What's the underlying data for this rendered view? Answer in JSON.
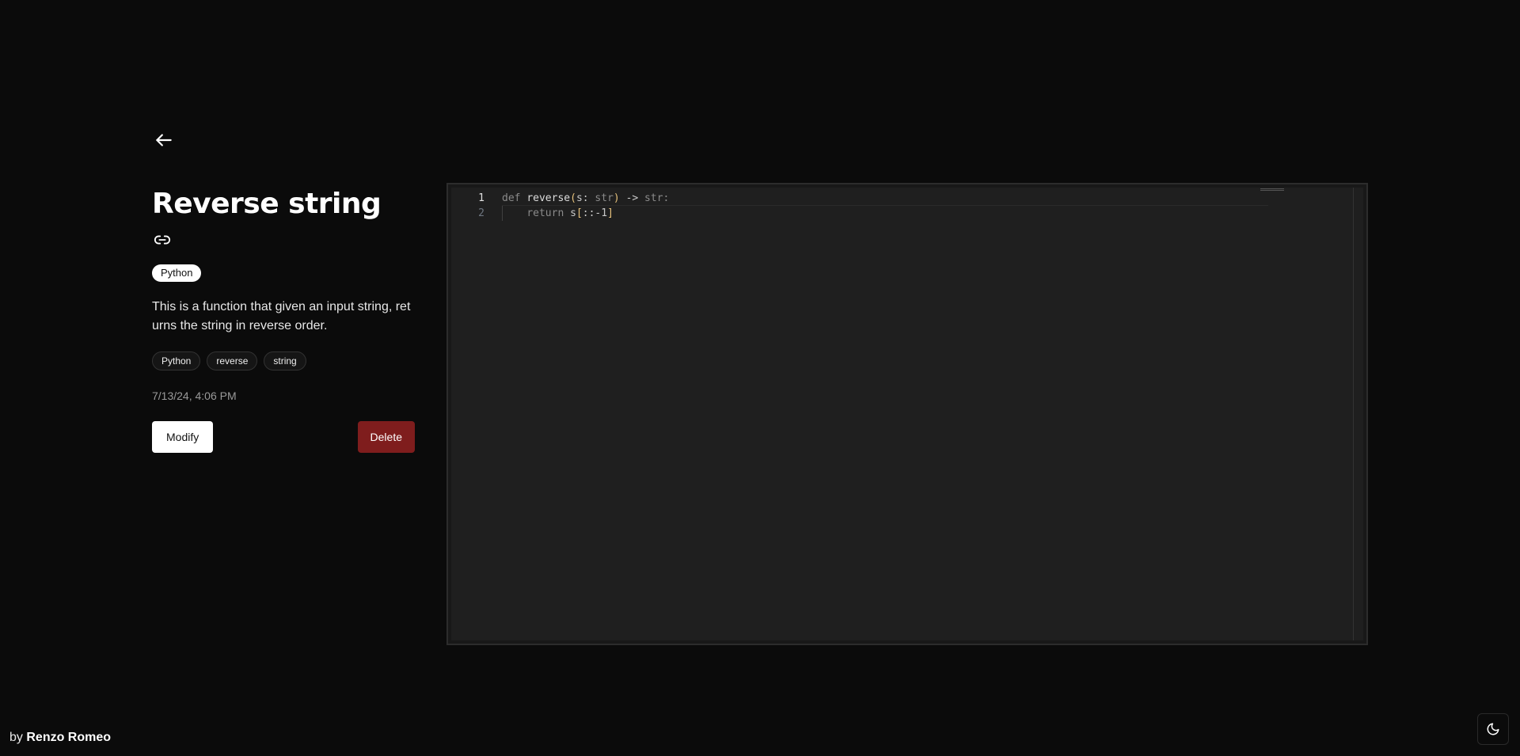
{
  "icons": {
    "back": "arrow-left-icon",
    "link": "link-icon",
    "theme": "moon-icon"
  },
  "snippet": {
    "title": "Reverse string",
    "language": "Python",
    "description": "This is a function that given an input string, returns the string in reverse order.",
    "tags": [
      "Python",
      "reverse",
      "string"
    ],
    "date": "7/13/24, 4:06 PM"
  },
  "actions": {
    "modify_label": "Modify",
    "delete_label": "Delete"
  },
  "editor": {
    "line_numbers": [
      "1",
      "2"
    ],
    "line1": {
      "kw": "def",
      "fn": "reverse",
      "open": "(",
      "param": "s:",
      "type": "str",
      "close": ")",
      "arrow": "->",
      "ret": "str:"
    },
    "line2": {
      "kw": "return",
      "expr": "s",
      "open": "[",
      "slice": "::-1",
      "close": "]"
    }
  },
  "footer": {
    "prefix": "by",
    "author": "Renzo Romeo"
  },
  "colors": {
    "background": "#0b0b0b",
    "delete": "#7f1d1d",
    "bracket": "#e5c07b"
  }
}
